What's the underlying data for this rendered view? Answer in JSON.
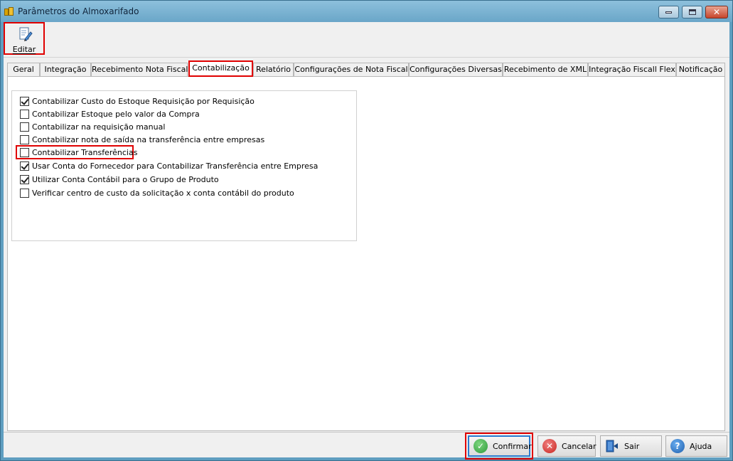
{
  "window": {
    "title": "Parâmetros do Almoxarifado"
  },
  "toolbar": {
    "edit_label": "Editar"
  },
  "tabs": [
    {
      "label": "Geral",
      "active": false
    },
    {
      "label": "Integração",
      "active": false
    },
    {
      "label": "Recebimento Nota Fiscal",
      "active": false
    },
    {
      "label": "Contabilização",
      "active": true
    },
    {
      "label": "Relatório",
      "active": false
    },
    {
      "label": "Configurações de Nota Fiscal",
      "active": false
    },
    {
      "label": "Configurações Diversas",
      "active": false
    },
    {
      "label": "Recebimento de XML",
      "active": false
    },
    {
      "label": "Integração Fiscall Flex",
      "active": false
    },
    {
      "label": "Notificação",
      "active": false
    }
  ],
  "options": [
    {
      "label": "Contabilizar Custo do Estoque Requisição por Requisição",
      "checked": true
    },
    {
      "label": "Contabilizar Estoque pelo valor da Compra",
      "checked": false
    },
    {
      "label": "Contabilizar na requisição manual",
      "checked": false
    },
    {
      "label": "Contabilizar nota de saída na transferência entre empresas",
      "checked": false
    },
    {
      "label": "Contabilizar Transferências",
      "checked": false
    },
    {
      "label": "Usar Conta do Fornecedor para Contabilizar Transferência entre Empresa",
      "checked": true
    },
    {
      "label": "Utilizar Conta Contábil para o Grupo de Produto",
      "checked": true
    },
    {
      "label": "Verificar centro de custo da solicitação x conta contábil do produto",
      "checked": false
    }
  ],
  "buttons": {
    "confirm": "Confirmar",
    "cancel": "Cancelar",
    "exit": "Sair",
    "help": "Ajuda"
  },
  "colors": {
    "highlight": "#e00000",
    "title_bar": "#7ab4d4"
  }
}
